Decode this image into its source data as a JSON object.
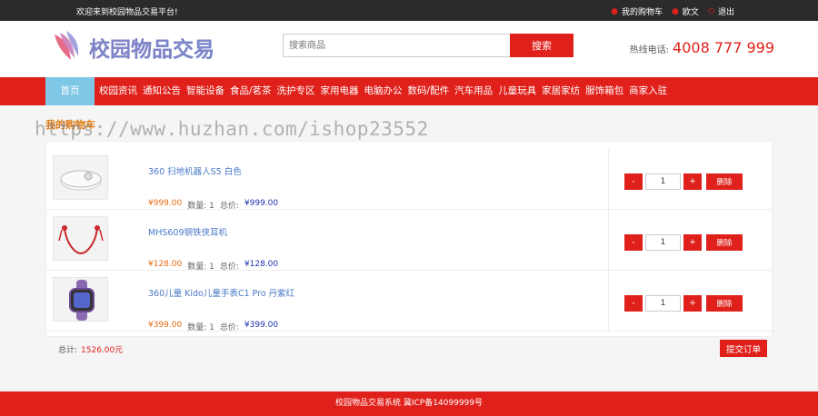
{
  "topbar": {
    "welcome": "欢迎来到校园物品交易平台!",
    "links": [
      {
        "label": "我的购物车",
        "icon": "user-icon"
      },
      {
        "label": "欧文",
        "icon": "user-icon"
      },
      {
        "label": "退出",
        "icon": "power-icon"
      }
    ]
  },
  "header": {
    "logo_text": "校园物品交易",
    "search_placeholder": "搜索商品",
    "search_button": "搜索",
    "hotline_label": "热线电话:",
    "hotline_number": "4008 777 999"
  },
  "nav": {
    "items": [
      "首页",
      "校园资讯",
      "通知公告",
      "智能设备",
      "食品/茗茶",
      "洗护专区",
      "家用电器",
      "电脑办公",
      "数码/配件",
      "汽车用品",
      "儿童玩具",
      "家居家纺",
      "服饰箱包",
      "商家入驻"
    ]
  },
  "page_title": "我的购物车",
  "watermark": "https://www.huzhan.com/ishop23552",
  "cart": {
    "qty_label": "数量:",
    "total_label": "总价:",
    "minus": "-",
    "plus": "+",
    "delete": "删除",
    "items": [
      {
        "name": "360 扫地机器人S5 白色",
        "price": "¥999.00",
        "qty": "1",
        "total": "¥999.00",
        "qty_value": "1"
      },
      {
        "name": "MHS609钢铁侠耳机",
        "price": "¥128.00",
        "qty": "1",
        "total": "¥128.00",
        "qty_value": "1"
      },
      {
        "name": "360儿童 Kido儿童手表C1 Pro 丹紫红",
        "price": "¥399.00",
        "qty": "1",
        "total": "¥399.00",
        "qty_value": "1"
      }
    ]
  },
  "summary": {
    "label": "总计:",
    "amount": "1526.00元",
    "submit": "提交订单"
  },
  "footer": "校园物品交易系统 冀ICP备14099999号",
  "colors": {
    "primary": "#e0201a",
    "nav_home": "#7fc7e6",
    "topbar": "#2b2b2b",
    "price": "#e86a10",
    "link": "#4a78c8"
  }
}
